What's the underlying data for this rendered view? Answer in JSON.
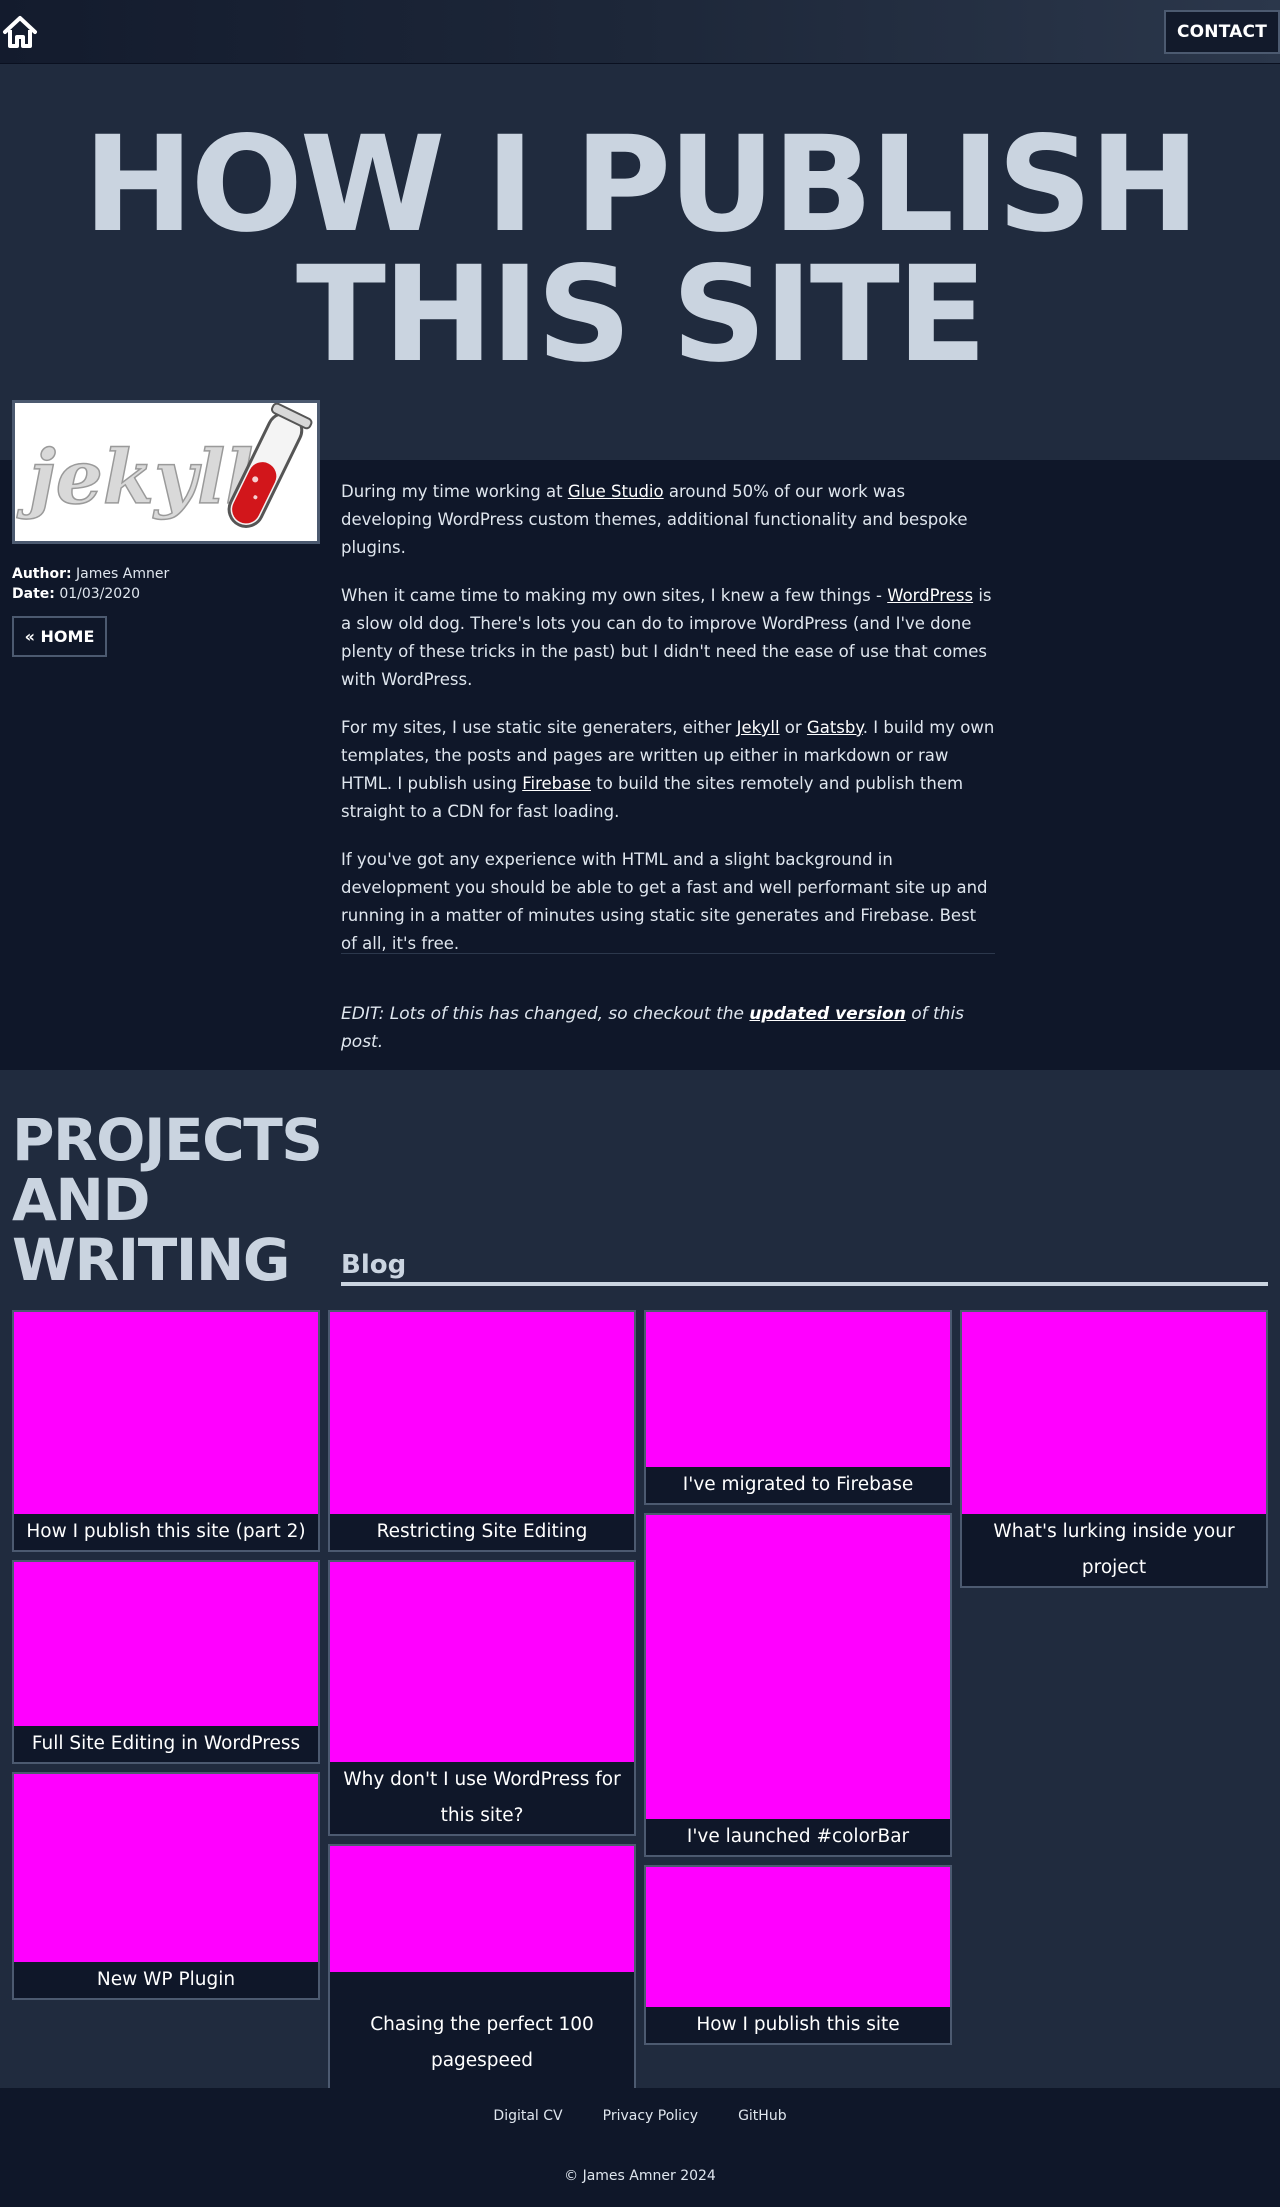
{
  "header": {
    "home_icon": "home-icon",
    "contact_label": "CONTACT"
  },
  "hero": {
    "title": "How I publish this site"
  },
  "sidebar": {
    "image_alt_text": "jekyll",
    "author_label": "Author:",
    "author": "James Amner",
    "date_label": "Date:",
    "date": "01/03/2020",
    "home_button": "« HOME"
  },
  "article": {
    "p1": {
      "t1": "During my time working at ",
      "l1": "Glue Studio",
      "t2": " around 50% of our work was developing WordPress custom themes, additional functionality and bespoke plugins."
    },
    "p2": {
      "t1": "When it came time to making my own sites, I knew a few things - ",
      "l1": "WordPress",
      "t2": " is a slow old dog. There's lots you can do to improve WordPress (and I've done plenty of these tricks in the past) but I didn't need the ease of use that comes with WordPress."
    },
    "p3": {
      "t1": "For my sites, I use static site generaters, either ",
      "l1": "Jekyll",
      "t2": " or ",
      "l2": "Gatsby",
      "t3": ". I build my own templates, the posts and pages are written up either in markdown or raw HTML. I publish using ",
      "l3": "Firebase",
      "t4": " to build the sites remotely and publish them straight to a CDN for fast loading."
    },
    "p4": "If you've got any experience with HTML and a slight background in development you should be able to get a fast and well performant site up and running in a matter of minutes using static site generates and Firebase. Best of all, it's free.",
    "edit": {
      "t1": "EDIT: Lots of this has changed, so checkout the ",
      "link": "updated version",
      "t2": " of this post."
    }
  },
  "projects": {
    "title": "Projects and Writing",
    "blog_heading": "Blog",
    "cards": [
      "How I publish this site (part 2)",
      "Restricting Site Editing",
      "I've migrated to Firebase",
      "What's lurking inside your project",
      "Full Site Editing in WordPress",
      "Why don't I use WordPress for this site?",
      "I've launched #colorBar",
      "New WP Plugin",
      "Chasing the perfect 100 pagespeed",
      "How I publish this site"
    ],
    "thumb_color": "#ff00ff"
  },
  "footer": {
    "links": [
      "Digital CV",
      "Privacy Policy",
      "GitHub"
    ],
    "copyright": "© James Amner 2024"
  }
}
